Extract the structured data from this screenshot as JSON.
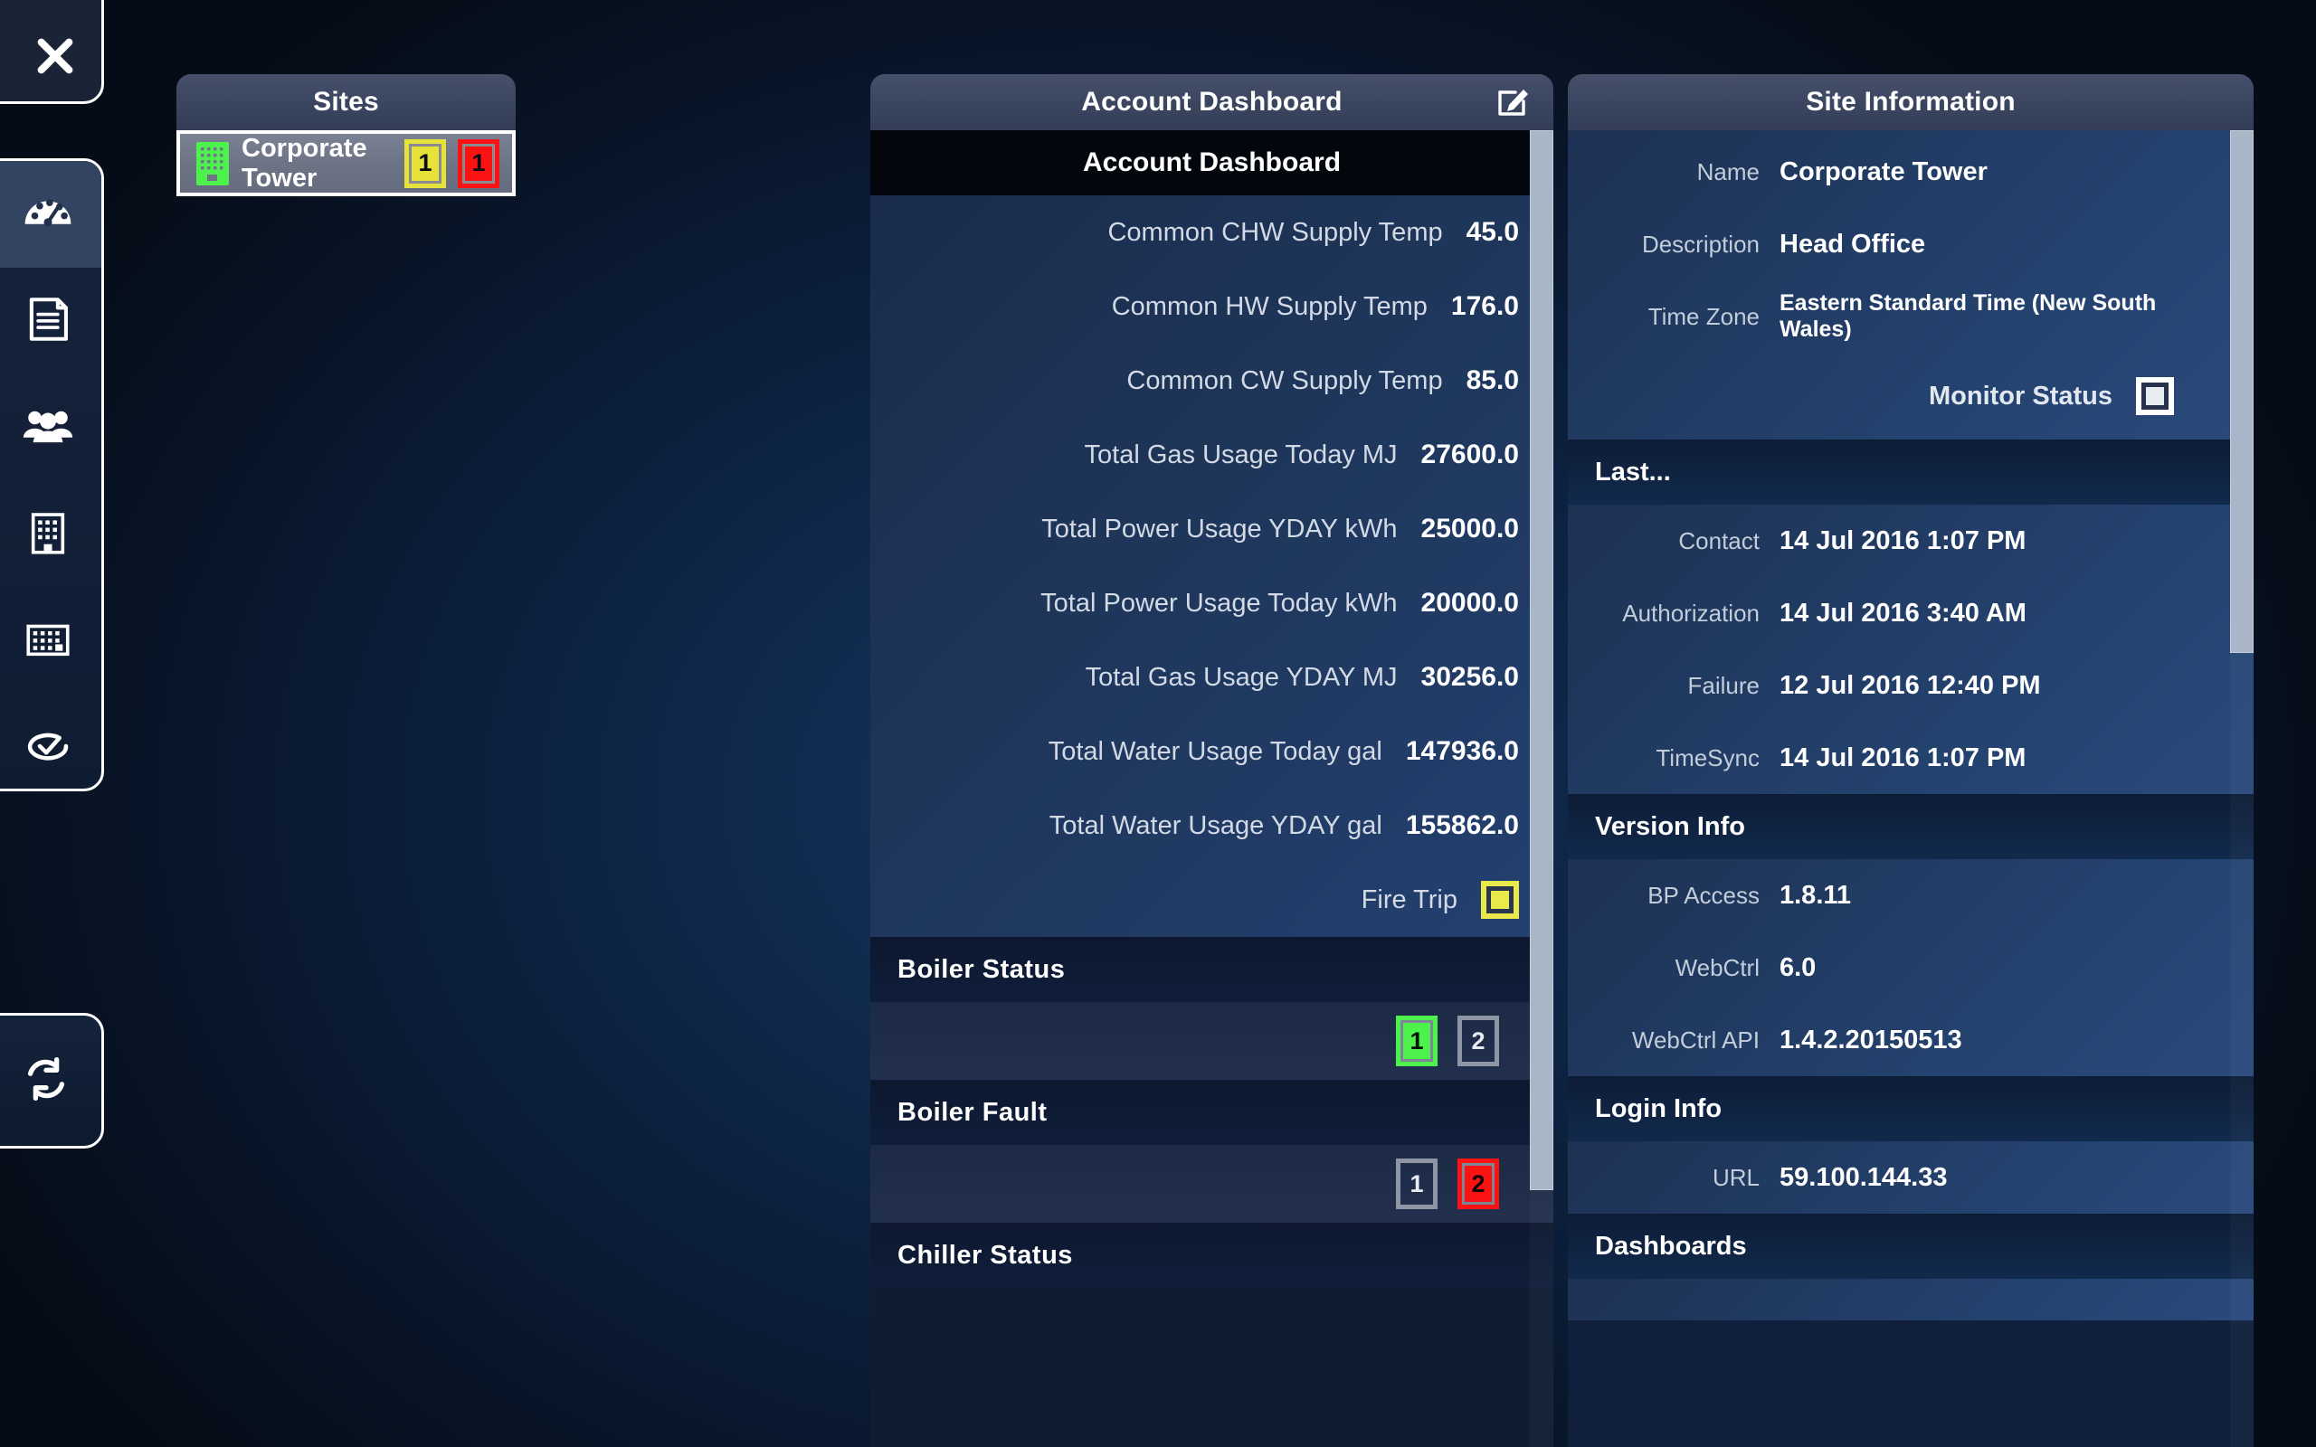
{
  "rail": {
    "close_label": "Close",
    "items": [
      {
        "icon": "gauge-icon",
        "name": "dashboard",
        "active": true
      },
      {
        "icon": "document-icon",
        "name": "reports",
        "active": false
      },
      {
        "icon": "people-icon",
        "name": "users",
        "active": false
      },
      {
        "icon": "building-icon",
        "name": "sites",
        "active": false
      },
      {
        "icon": "keypad-icon",
        "name": "equipment",
        "active": false
      },
      {
        "icon": "clock-check-icon",
        "name": "schedules",
        "active": false
      }
    ],
    "refresh_icon": "refresh-icon"
  },
  "sites": {
    "title": "Sites",
    "rows": [
      {
        "icon": "building-icon",
        "name": "Corporate Tower",
        "badges": [
          {
            "count": "1",
            "color": "#e6e23a",
            "kind": "warning"
          },
          {
            "count": "1",
            "color": "#fb1212",
            "kind": "alarm"
          }
        ]
      }
    ]
  },
  "dashboard": {
    "title": "Account Dashboard",
    "edit_icon": "edit-pencil-icon",
    "subheader": "Account Dashboard",
    "metrics": [
      {
        "label": "Common CHW Supply Temp",
        "value": "45.0"
      },
      {
        "label": "Common HW Supply Temp",
        "value": "176.0"
      },
      {
        "label": "Common CW Supply Temp",
        "value": "85.0"
      },
      {
        "label": "Total Gas Usage Today MJ",
        "value": "27600.0"
      },
      {
        "label": "Total Power Usage YDAY kWh",
        "value": "25000.0"
      },
      {
        "label": "Total Power Usage Today kWh",
        "value": "20000.0"
      },
      {
        "label": "Total Gas Usage YDAY MJ",
        "value": "30256.0"
      },
      {
        "label": "Total Water Usage Today gal",
        "value": "147936.0"
      },
      {
        "label": "Total Water Usage YDAY gal",
        "value": "155862.0"
      }
    ],
    "fire_trip": {
      "label": "Fire Trip",
      "indicator": "yellow-square-indicator",
      "color": "#e9e94b"
    },
    "groups": [
      {
        "title": "Boiler  Status",
        "badges": [
          {
            "count": "1",
            "state": "on",
            "color": "#4df24d"
          },
          {
            "count": "2",
            "state": "off",
            "color": "#8e96a6"
          }
        ]
      },
      {
        "title": "Boiler  Fault",
        "badges": [
          {
            "count": "1",
            "state": "off",
            "color": "#8e96a6"
          },
          {
            "count": "2",
            "state": "alarm",
            "color": "#fb1212"
          }
        ]
      },
      {
        "title": "Chiller  Status",
        "badges": []
      }
    ]
  },
  "site_information": {
    "title": "Site Information",
    "fields": [
      {
        "label": "Name",
        "value": "Corporate Tower"
      },
      {
        "label": "Description",
        "value": "Head Office"
      },
      {
        "label": "Time Zone",
        "value": "Eastern Standard Time (New South Wales)"
      }
    ],
    "monitor_status": {
      "label": "Monitor Status",
      "indicator": "white-square-indicator",
      "color": "#e8ecf2"
    },
    "sections": [
      {
        "title": "Last...",
        "rows": [
          {
            "label": "Contact",
            "value": "14 Jul 2016 1:07 PM"
          },
          {
            "label": "Authorization",
            "value": "14 Jul 2016 3:40 AM"
          },
          {
            "label": "Failure",
            "value": "12 Jul 2016 12:40 PM"
          },
          {
            "label": "TimeSync",
            "value": "14 Jul 2016 1:07 PM"
          }
        ]
      },
      {
        "title": "Version Info",
        "rows": [
          {
            "label": "BP Access",
            "value": "1.8.11"
          },
          {
            "label": "WebCtrl",
            "value": "6.0"
          },
          {
            "label": "WebCtrl API",
            "value": "1.4.2.20150513"
          }
        ]
      },
      {
        "title": "Login Info",
        "rows": [
          {
            "label": "URL",
            "value": "59.100.144.33"
          }
        ]
      },
      {
        "title": "Dashboards",
        "rows": []
      }
    ]
  }
}
